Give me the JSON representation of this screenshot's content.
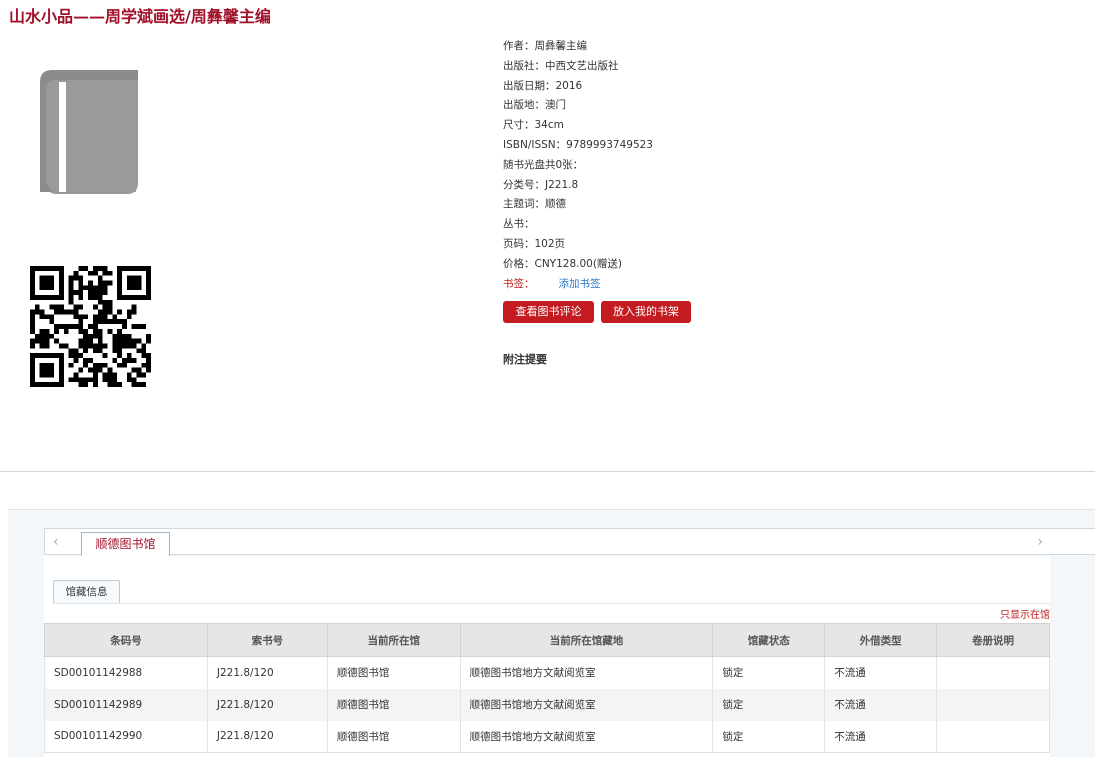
{
  "title": "山水小品——周学斌画选/周彝馨主编",
  "meta": [
    {
      "label": "作者：",
      "value": "周彝馨主编"
    },
    {
      "label": "出版社：",
      "value": "中西文艺出版社"
    },
    {
      "label": "出版日期：",
      "value": "2016"
    },
    {
      "label": "出版地：",
      "value": "澳门"
    },
    {
      "label": "尺寸：",
      "value": "34cm"
    },
    {
      "label": "ISBN/ISSN：",
      "value": "9789993749523"
    },
    {
      "label": "随书光盘共0张：",
      "value": ""
    },
    {
      "label": "分类号：",
      "value": "J221.8"
    },
    {
      "label": "主题词：",
      "value": "顺德"
    },
    {
      "label": "丛书：",
      "value": ""
    },
    {
      "label": "页码：",
      "value": "102页"
    },
    {
      "label": "价格：",
      "value": "CNY128.00(赠送)"
    }
  ],
  "tag": {
    "label": "书签：",
    "add_label": "添加书签"
  },
  "buttons": {
    "review": "查看图书评论",
    "shelf": "放入我的书架"
  },
  "notes_heading": "附注提要",
  "library_tab": "顺德图书馆",
  "sub_tab": "馆藏信息",
  "only_show": "只显示在馆",
  "table": {
    "headers": [
      "条码号",
      "索书号",
      "当前所在馆",
      "当前所在馆藏地",
      "馆藏状态",
      "外借类型",
      "卷册说明"
    ],
    "rows": [
      [
        "SD00101142988",
        "J221.8/120",
        "顺德图书馆",
        "顺德图书馆地方文献阅览室",
        "锁定",
        "不流通",
        ""
      ],
      [
        "SD00101142989",
        "J221.8/120",
        "顺德图书馆",
        "顺德图书馆地方文献阅览室",
        "锁定",
        "不流通",
        ""
      ],
      [
        "SD00101142990",
        "J221.8/120",
        "顺德图书馆",
        "顺德图书馆地方文献阅览室",
        "锁定",
        "不流通",
        ""
      ]
    ]
  },
  "colors": {
    "accent": "#a0102a",
    "button": "#c31b20",
    "link": "#2a79c6"
  },
  "icons": {
    "cover": "book-icon",
    "qr": "qr-code-icon"
  }
}
